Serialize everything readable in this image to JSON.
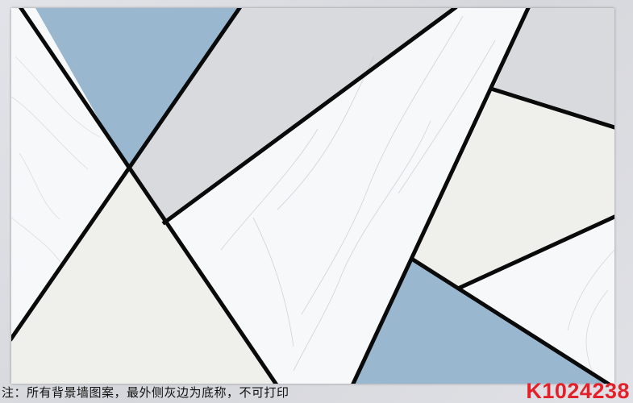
{
  "artwork": {
    "colors": {
      "blue": "#9ab7d0",
      "gray": "#d9dadd",
      "cream": "#efefeb",
      "marble": "#f7f8f9",
      "veins": "#c7cbd0",
      "line": "#0a0a0a"
    }
  },
  "footer": {
    "note": "注：所有背景墙图案，最外侧灰边为底称，不可打印",
    "code": "K1024238",
    "code_color": "#e4202a",
    "note_color": "#111111"
  }
}
